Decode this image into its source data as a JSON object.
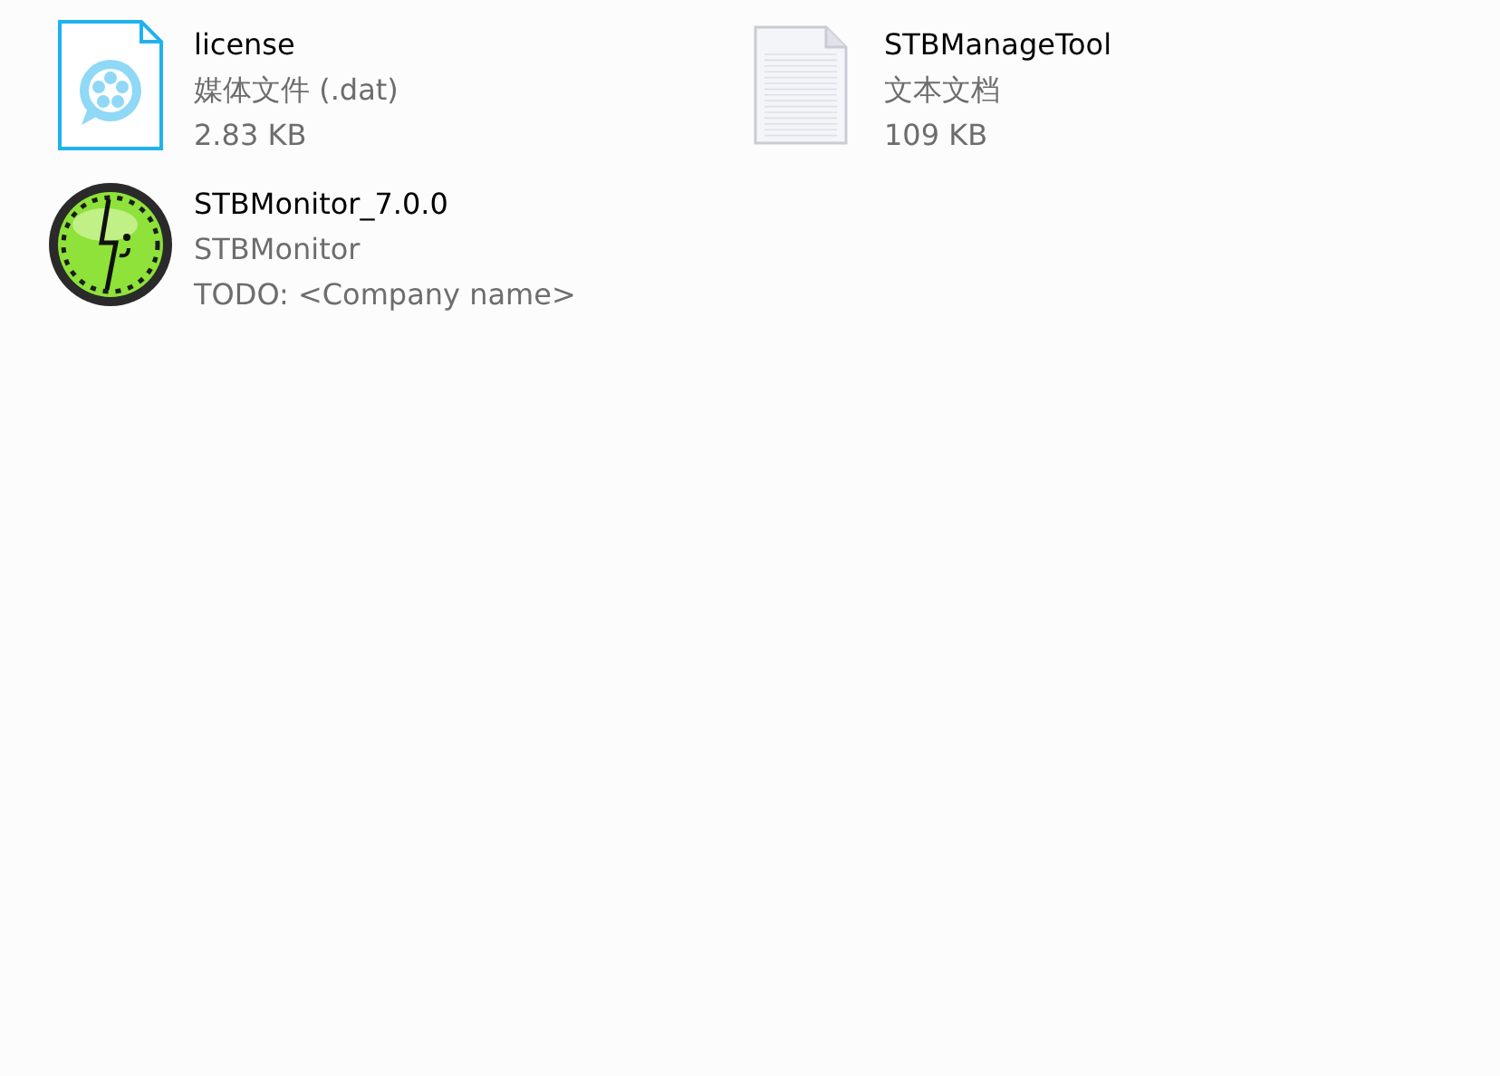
{
  "files": [
    {
      "kind": "media",
      "name": "license",
      "lines": [
        "媒体文件 (.dat)",
        "2.83 KB"
      ]
    },
    {
      "kind": "text",
      "name": "STBManageTool",
      "lines": [
        "文本文档",
        "109 KB"
      ]
    },
    {
      "kind": "app",
      "name": "STBMonitor_7.0.0",
      "lines": [
        "STBMonitor",
        "TODO: <Company name>"
      ]
    }
  ]
}
